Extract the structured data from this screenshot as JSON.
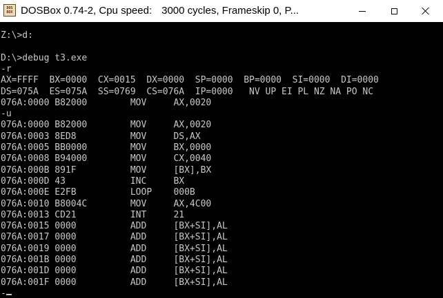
{
  "window": {
    "title_app": "DOSBox 0.74-2, Cpu speed:",
    "title_cycles": "3000 cycles, Frameskip  0, P...",
    "icon_top": "DOS",
    "icon_bottom": "BOX"
  },
  "console": {
    "lines": [
      "Z:\\>d:",
      "",
      "D:\\>debug t3.exe",
      "-r",
      "AX=FFFF  BX=0000  CX=0015  DX=0000  SP=0000  BP=0000  SI=0000  DI=0000",
      "DS=075A  ES=075A  SS=0769  CS=076A  IP=0000   NV UP EI PL NZ NA PO NC",
      "076A:0000 B82000        MOV     AX,0020",
      "-u",
      "076A:0000 B82000        MOV     AX,0020",
      "076A:0003 8ED8          MOV     DS,AX",
      "076A:0005 BB0000        MOV     BX,0000",
      "076A:0008 B94000        MOV     CX,0040",
      "076A:000B 891F          MOV     [BX],BX",
      "076A:000D 43            INC     BX",
      "076A:000E E2FB          LOOP    000B",
      "076A:0010 B8004C        MOV     AX,4C00",
      "076A:0013 CD21          INT     21",
      "076A:0015 0000          ADD     [BX+SI],AL",
      "076A:0017 0000          ADD     [BX+SI],AL",
      "076A:0019 0000          ADD     [BX+SI],AL",
      "076A:001B 0000          ADD     [BX+SI],AL",
      "076A:001D 0000          ADD     [BX+SI],AL",
      "076A:001F 0000          ADD     [BX+SI],AL",
      "-"
    ]
  },
  "colors": {
    "screen_background": "#000000",
    "text": "#c8c8c8",
    "titlebar": "#ffffff"
  }
}
